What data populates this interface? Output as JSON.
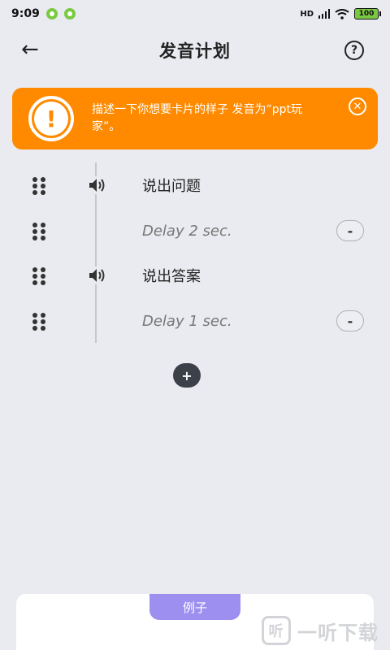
{
  "status_bar": {
    "time": "9:09",
    "network": "HD",
    "battery": "100"
  },
  "header": {
    "back_label": "←",
    "title": "发音计划",
    "help_label": "?"
  },
  "banner": {
    "icon_label": "!",
    "text": "描述一下你想要卡片的样子 发音为“ppt玩家”。",
    "close_label": "✕",
    "color": "#ff8a00"
  },
  "steps": [
    {
      "type": "speak",
      "label": "说出问题"
    },
    {
      "type": "delay",
      "label": "Delay 2 sec.",
      "remove_label": "-"
    },
    {
      "type": "speak",
      "label": "说出答案"
    },
    {
      "type": "delay",
      "label": "Delay 1 sec.",
      "remove_label": "-"
    }
  ],
  "add_label": "+",
  "example": {
    "tab_label": "例子",
    "tab_color": "#9d8ff0"
  },
  "watermark": {
    "logo": "听",
    "text": "一听下载"
  }
}
